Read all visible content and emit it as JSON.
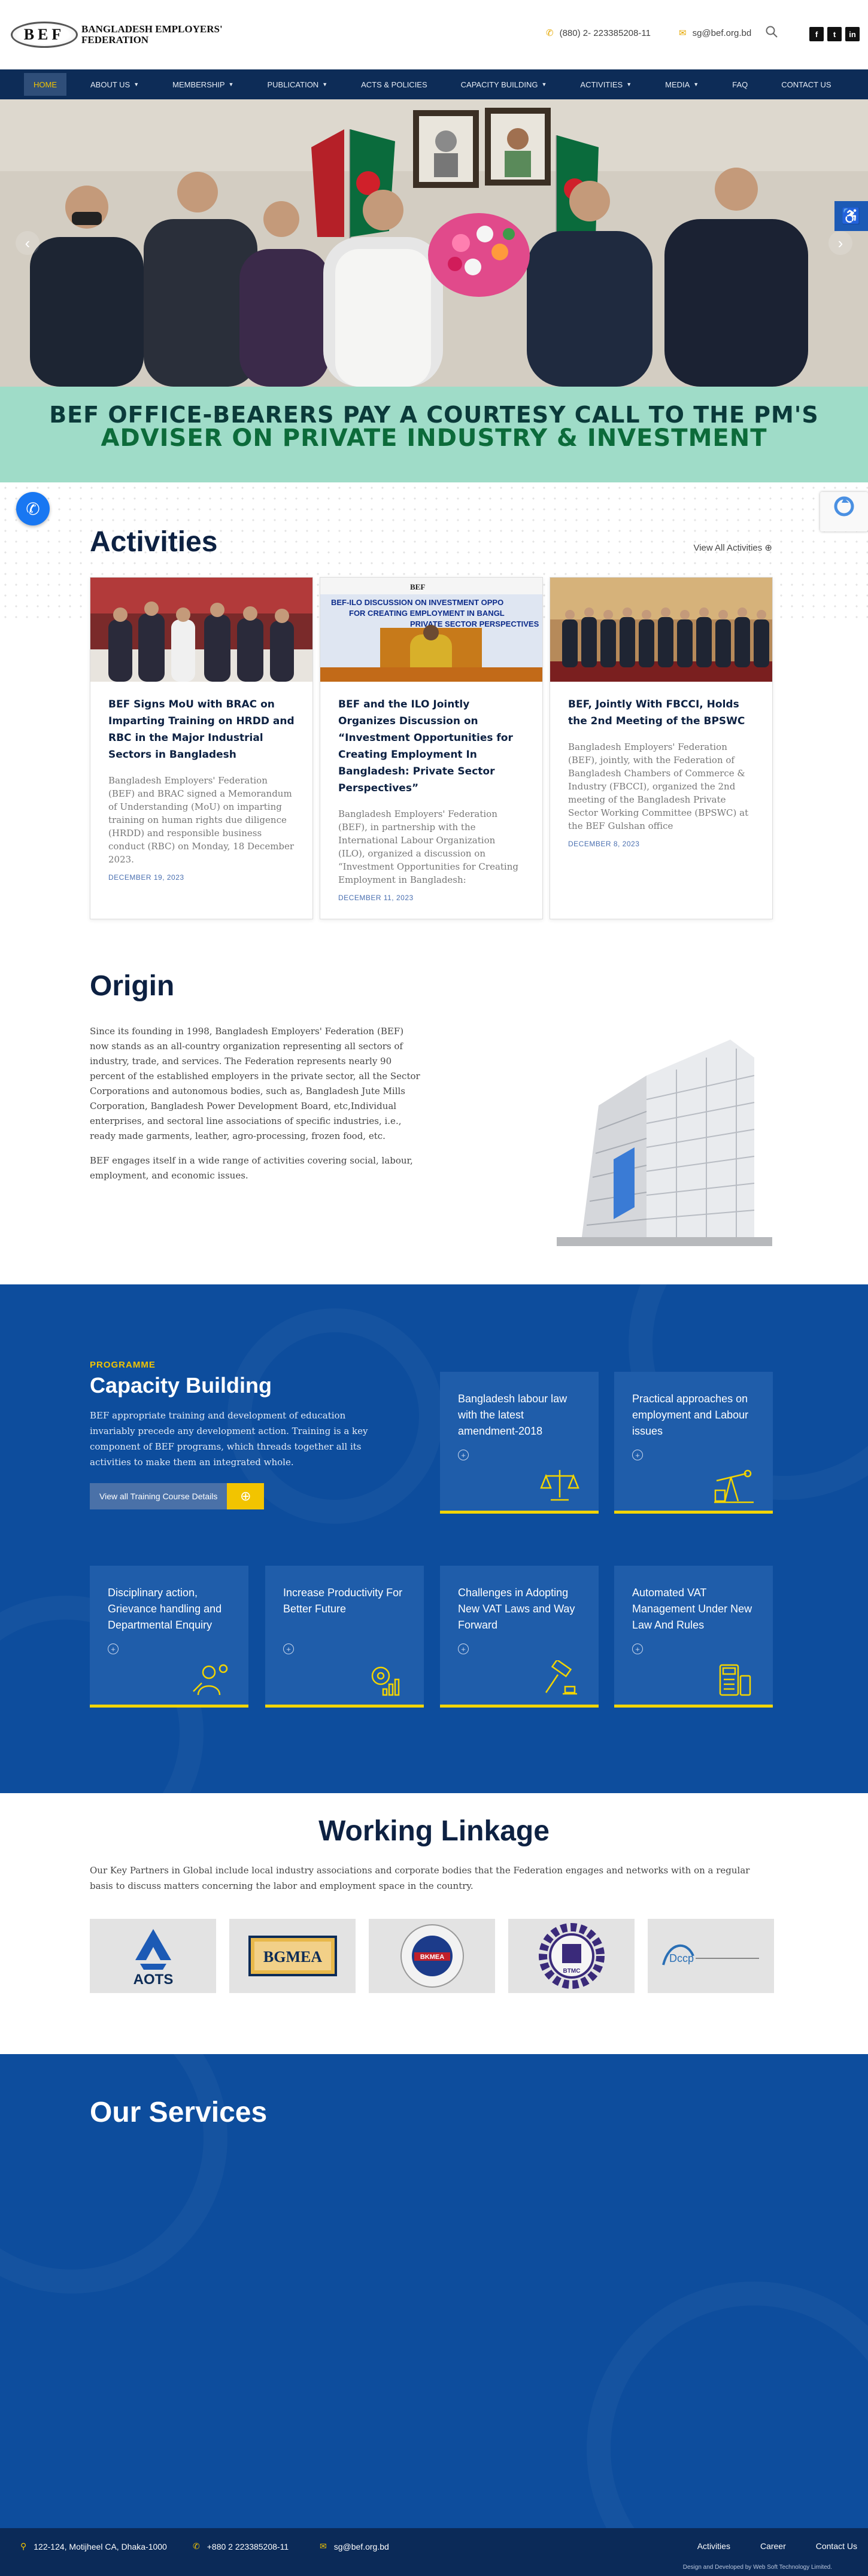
{
  "header": {
    "logo_abbr": "BEF",
    "logo_line1": "BANGLADESH EMPLOYERS'",
    "logo_line2": "FEDERATION",
    "phone": "(880) 2- 223385208-11",
    "email": "sg@bef.org.bd",
    "social": [
      "f",
      "t",
      "in"
    ]
  },
  "nav": {
    "items": [
      {
        "label": "HOME",
        "caret": false
      },
      {
        "label": "ABOUT US",
        "caret": true
      },
      {
        "label": "MEMBERSHIP",
        "caret": true
      },
      {
        "label": "PUBLICATION",
        "caret": true
      },
      {
        "label": "ACTS & POLICIES",
        "caret": false
      },
      {
        "label": "CAPACITY BUILDING",
        "caret": true
      },
      {
        "label": "ACTIVITIES",
        "caret": true
      },
      {
        "label": "MEDIA",
        "caret": true
      },
      {
        "label": "FAQ",
        "caret": false
      },
      {
        "label": "CONTACT US",
        "caret": false
      }
    ]
  },
  "hero": {
    "banner_line1": "BEF OFFICE-BEARERS PAY A COURTESY CALL TO THE PM'S",
    "banner_line2": "ADVISER ON PRIVATE INDUSTRY & INVESTMENT"
  },
  "activities": {
    "title": "Activities",
    "view_all": "View All Activities",
    "cards": [
      {
        "title": "BEF Signs MoU with BRAC on Imparting Training on HRDD and RBC in the Major Industrial Sectors in Bangladesh",
        "excerpt": "Bangladesh Employers' Federation (BEF) and BRAC signed a Memorandum of Understanding (MoU) on imparting training on human rights due diligence (HRDD) and responsible business conduct (RBC) on Monday, 18 December 2023.",
        "date": "DECEMBER 19, 2023"
      },
      {
        "title": "BEF and the ILO Jointly Organizes Discussion on “Investment Opportunities for Creating Employment In Bangladesh: Private Sector Perspectives”",
        "excerpt": "Bangladesh Employers' Federation (BEF), in partnership with the International Labour Organization (ILO), organized a discussion on “Investment Opportunities for Creating Employment in Bangladesh:",
        "date": "DECEMBER 11, 2023",
        "img_text1": "BEF-ILO DISCUSSION ON INVESTMENT OPPO",
        "img_text2": "FOR CREATING EMPLOYMENT IN BANGL",
        "img_text3": "PRIVATE SECTOR PERSPECTIVES"
      },
      {
        "title": "BEF, Jointly With FBCCI, Holds the 2nd Meeting of the BPSWC",
        "excerpt": "Bangladesh Employers' Federation (BEF), jointly, with the Federation of Bangladesh Chambers of Commerce & Industry (FBCCI), organized the 2nd meeting of the Bangladesh Private Sector Working Committee (BPSWC) at the BEF Gulshan office",
        "date": "DECEMBER 8, 2023"
      }
    ]
  },
  "origin": {
    "title": "Origin",
    "p1": "Since its founding in 1998, Bangladesh Employers' Federation (BEF) now stands as an all-country organization representing all sectors of industry, trade, and services. The Federation represents nearly 90 percent of the established employers in the private sector, all the Sector Corporations and autonomous bodies, such as, Bangladesh Jute Mills Corporation, Bangladesh Power Development Board, etc,Individual enterprises, and sectoral line associations of specific industries, i.e., ready made garments, leather, agro-processing, frozen food, etc.",
    "p2": "BEF engages itself in a wide range of activities covering social, labour, employment, and economic issues."
  },
  "programme": {
    "label": "PROGRAMME",
    "title": "Capacity Building",
    "text": "BEF appropriate training and development of education invariably precede any development action. Training is a key component of BEF programs, which threads together all its activities to make them an integrated whole.",
    "button": "View all Training Course Details",
    "cards": [
      "Bangladesh labour law with the latest amendment-2018",
      "Practical approaches on employment and Labour issues",
      "Disciplinary action, Grievance handling and Departmental Enquiry",
      "Increase Productivity For Better Future",
      "Challenges in Adopting New VAT Laws and Way Forward",
      "Automated VAT Management Under New Law And Rules"
    ]
  },
  "linkage": {
    "title": "Working Linkage",
    "text": "Our Key Partners in Global include local industry associations and corporate bodies that the Federation engages and networks with on a regular basis to discuss matters concerning the labor and employment space in the country.",
    "logos": [
      "AOTS",
      "BGMEA",
      "BKMEA",
      "BTMC",
      "Dccp"
    ]
  },
  "services": {
    "title": "Our Services"
  },
  "footer": {
    "address": "122-124, Motijheel CA, Dhaka-1000",
    "phone": "+880 2 223385208-11",
    "email": "sg@bef.org.bd",
    "links": [
      "Activities",
      "Career",
      "Contact Us"
    ],
    "credit": "Design and Developed by Web Soft Technology Limited."
  },
  "colors": {
    "nav_bg": "#0d2c57",
    "accent_yellow": "#f2c400",
    "programme_bg": "#0d4d9d",
    "banner_bg": "#9fdcc8",
    "heading": "#0d2142"
  },
  "icons": [
    "phone-icon",
    "mail-icon",
    "search-icon",
    "facebook-icon",
    "twitter-icon",
    "linkedin-icon",
    "accessibility-icon",
    "messenger-icon",
    "recaptcha-icon",
    "arrow-left-icon",
    "arrow-right-icon",
    "location-icon"
  ]
}
